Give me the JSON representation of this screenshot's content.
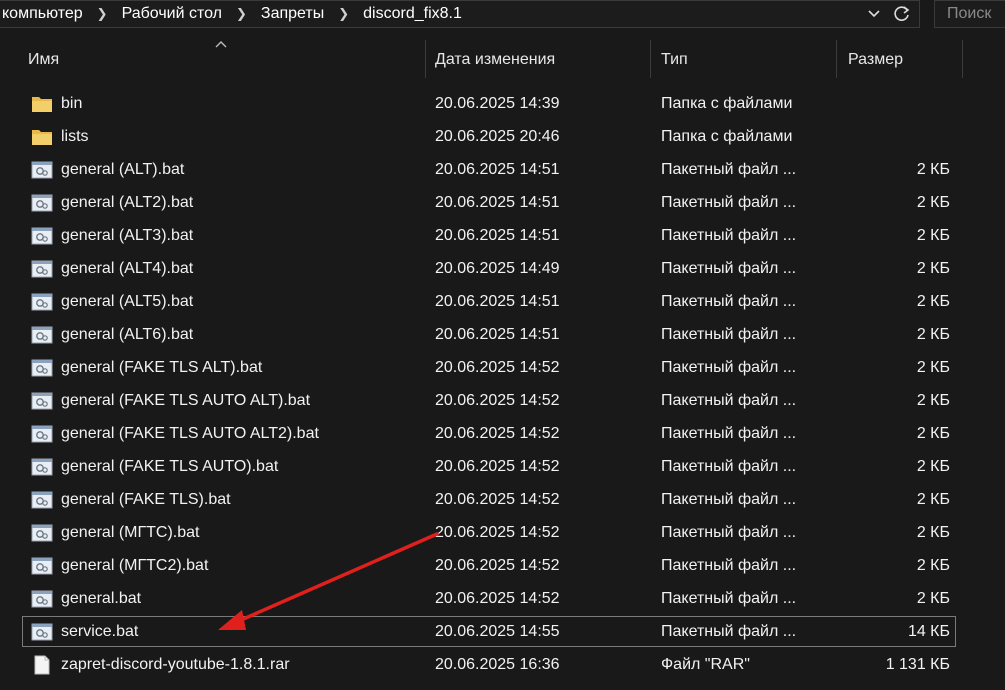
{
  "address_bar": {
    "crumbs": [
      "компьютер",
      "Рабочий стол",
      "Запреты",
      "discord_fix8.1"
    ]
  },
  "search": {
    "placeholder": "Поиск"
  },
  "columns": {
    "name": "Имя",
    "date": "Дата изменения",
    "type": "Тип",
    "size": "Размер"
  },
  "files": [
    {
      "name": "bin",
      "date": "20.06.2025 14:39",
      "type": "Папка с файлами",
      "size": "",
      "icon": "folder-icon"
    },
    {
      "name": "lists",
      "date": "20.06.2025 20:46",
      "type": "Папка с файлами",
      "size": "",
      "icon": "folder-icon"
    },
    {
      "name": "general (ALT).bat",
      "date": "20.06.2025 14:51",
      "type": "Пакетный файл ...",
      "size": "2 КБ",
      "icon": "batch-file-icon"
    },
    {
      "name": "general (ALT2).bat",
      "date": "20.06.2025 14:51",
      "type": "Пакетный файл ...",
      "size": "2 КБ",
      "icon": "batch-file-icon"
    },
    {
      "name": "general (ALT3).bat",
      "date": "20.06.2025 14:51",
      "type": "Пакетный файл ...",
      "size": "2 КБ",
      "icon": "batch-file-icon"
    },
    {
      "name": "general (ALT4).bat",
      "date": "20.06.2025 14:49",
      "type": "Пакетный файл ...",
      "size": "2 КБ",
      "icon": "batch-file-icon"
    },
    {
      "name": "general (ALT5).bat",
      "date": "20.06.2025 14:51",
      "type": "Пакетный файл ...",
      "size": "2 КБ",
      "icon": "batch-file-icon"
    },
    {
      "name": "general (ALT6).bat",
      "date": "20.06.2025 14:51",
      "type": "Пакетный файл ...",
      "size": "2 КБ",
      "icon": "batch-file-icon"
    },
    {
      "name": "general (FAKE TLS ALT).bat",
      "date": "20.06.2025 14:52",
      "type": "Пакетный файл ...",
      "size": "2 КБ",
      "icon": "batch-file-icon"
    },
    {
      "name": "general (FAKE TLS AUTO ALT).bat",
      "date": "20.06.2025 14:52",
      "type": "Пакетный файл ...",
      "size": "2 КБ",
      "icon": "batch-file-icon"
    },
    {
      "name": "general (FAKE TLS AUTO ALT2).bat",
      "date": "20.06.2025 14:52",
      "type": "Пакетный файл ...",
      "size": "2 КБ",
      "icon": "batch-file-icon"
    },
    {
      "name": "general (FAKE TLS AUTO).bat",
      "date": "20.06.2025 14:52",
      "type": "Пакетный файл ...",
      "size": "2 КБ",
      "icon": "batch-file-icon"
    },
    {
      "name": "general (FAKE TLS).bat",
      "date": "20.06.2025 14:52",
      "type": "Пакетный файл ...",
      "size": "2 КБ",
      "icon": "batch-file-icon"
    },
    {
      "name": "general (МГТС).bat",
      "date": "20.06.2025 14:52",
      "type": "Пакетный файл ...",
      "size": "2 КБ",
      "icon": "batch-file-icon"
    },
    {
      "name": "general (МГТС2).bat",
      "date": "20.06.2025 14:52",
      "type": "Пакетный файл ...",
      "size": "2 КБ",
      "icon": "batch-file-icon"
    },
    {
      "name": "general.bat",
      "date": "20.06.2025 14:52",
      "type": "Пакетный файл ...",
      "size": "2 КБ",
      "icon": "batch-file-icon"
    },
    {
      "name": "service.bat",
      "date": "20.06.2025 14:55",
      "type": "Пакетный файл ...",
      "size": "14 КБ",
      "icon": "batch-file-icon",
      "selected": true
    },
    {
      "name": "zapret-discord-youtube-1.8.1.rar",
      "date": "20.06.2025 16:36",
      "type": "Файл \"RAR\"",
      "size": "1 131 КБ",
      "icon": "file-icon"
    }
  ],
  "colors": {
    "background": "#191919",
    "folder": "#e8b84a",
    "annotation_arrow": "#e0201c"
  }
}
